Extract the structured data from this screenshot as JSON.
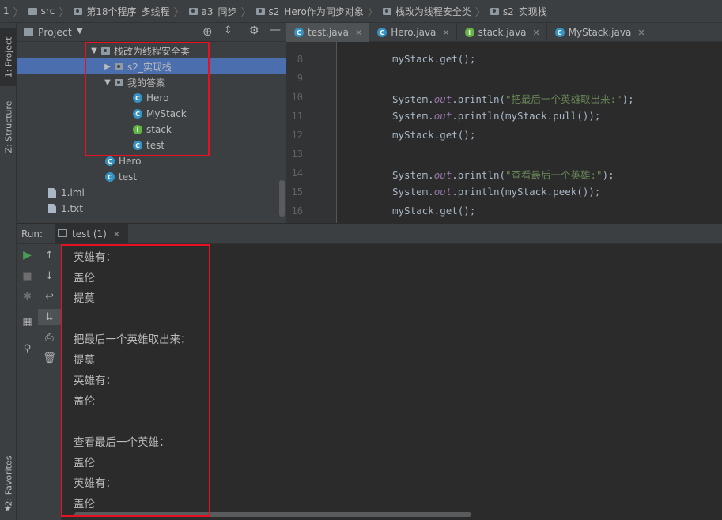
{
  "breadcrumb": {
    "items": [
      {
        "label": "1",
        "icon": "none"
      },
      {
        "label": "src",
        "icon": "folder-icon"
      },
      {
        "label": "第18个程序_多线程",
        "icon": "package-icon"
      },
      {
        "label": "a3_同步",
        "icon": "package-icon"
      },
      {
        "label": "s2_Hero作为同步对象",
        "icon": "package-icon"
      },
      {
        "label": "栈改为线程安全类",
        "icon": "package-icon"
      },
      {
        "label": "s2_实现栈",
        "icon": "package-icon"
      }
    ]
  },
  "left_strip": {
    "project_label": "1: Project",
    "structure_label": "Z: Structure",
    "favorites_label": "2: Favorites"
  },
  "project_panel": {
    "title": "Project",
    "tree": [
      {
        "label": "栈改为线程安全类",
        "type": "package",
        "expanded": true
      },
      {
        "label": "s2_实现栈",
        "type": "package",
        "expanded": false,
        "selected": true
      },
      {
        "label": "我的答案",
        "type": "package",
        "expanded": true
      },
      {
        "label": "Hero",
        "type": "class"
      },
      {
        "label": "MyStack",
        "type": "class"
      },
      {
        "label": "stack",
        "type": "interface"
      },
      {
        "label": "test",
        "type": "runnable-class"
      },
      {
        "label": "Hero",
        "type": "class"
      },
      {
        "label": "test",
        "type": "runnable-class"
      },
      {
        "label": "1.iml",
        "type": "file"
      },
      {
        "label": "1.txt",
        "type": "file"
      }
    ]
  },
  "editor": {
    "tabs": [
      {
        "label": "test.java",
        "icon": "runnable-class-icon",
        "active": true
      },
      {
        "label": "Hero.java",
        "icon": "class-icon",
        "active": false
      },
      {
        "label": "stack.java",
        "icon": "interface-icon",
        "active": false
      },
      {
        "label": "MyStack.java",
        "icon": "class-icon",
        "active": false
      }
    ],
    "lines": [
      {
        "num": "8",
        "tokens": [
          {
            "t": "myStack.get();",
            "c": "plain"
          }
        ]
      },
      {
        "num": "9",
        "tokens": []
      },
      {
        "num": "10",
        "tokens": [
          {
            "t": "System.",
            "c": "plain"
          },
          {
            "t": "out",
            "c": "out"
          },
          {
            "t": ".println(",
            "c": "plain"
          },
          {
            "t": "\"把最后一个英雄取出来:\"",
            "c": "str"
          },
          {
            "t": ");",
            "c": "plain"
          }
        ]
      },
      {
        "num": "11",
        "tokens": [
          {
            "t": "System.",
            "c": "plain"
          },
          {
            "t": "out",
            "c": "out"
          },
          {
            "t": ".println(myStack.pull());",
            "c": "plain"
          }
        ]
      },
      {
        "num": "12",
        "tokens": [
          {
            "t": "myStack.get();",
            "c": "plain"
          }
        ]
      },
      {
        "num": "13",
        "tokens": []
      },
      {
        "num": "14",
        "tokens": [
          {
            "t": "System.",
            "c": "plain"
          },
          {
            "t": "out",
            "c": "out"
          },
          {
            "t": ".println(",
            "c": "plain"
          },
          {
            "t": "\"查看最后一个英雄:\"",
            "c": "str"
          },
          {
            "t": ");",
            "c": "plain"
          }
        ]
      },
      {
        "num": "15",
        "tokens": [
          {
            "t": "System.",
            "c": "plain"
          },
          {
            "t": "out",
            "c": "out"
          },
          {
            "t": ".println(myStack.peek());",
            "c": "plain"
          }
        ]
      },
      {
        "num": "16",
        "tokens": [
          {
            "t": "myStack.get();",
            "c": "plain"
          }
        ]
      }
    ]
  },
  "run_panel": {
    "label": "Run:",
    "tab_label": "test (1)",
    "console_lines": [
      "英雄有：",
      "盖伦",
      "提莫",
      "",
      "把最后一个英雄取出来：",
      "提莫",
      "英雄有：",
      "盖伦",
      "",
      "查看最后一个英雄：",
      "盖伦",
      "英雄有：",
      "盖伦"
    ]
  },
  "colors": {
    "highlight_box": "#e81123",
    "selection": "#4b6eaf",
    "class_icon": "#3592c4",
    "interface_icon": "#62b543"
  }
}
